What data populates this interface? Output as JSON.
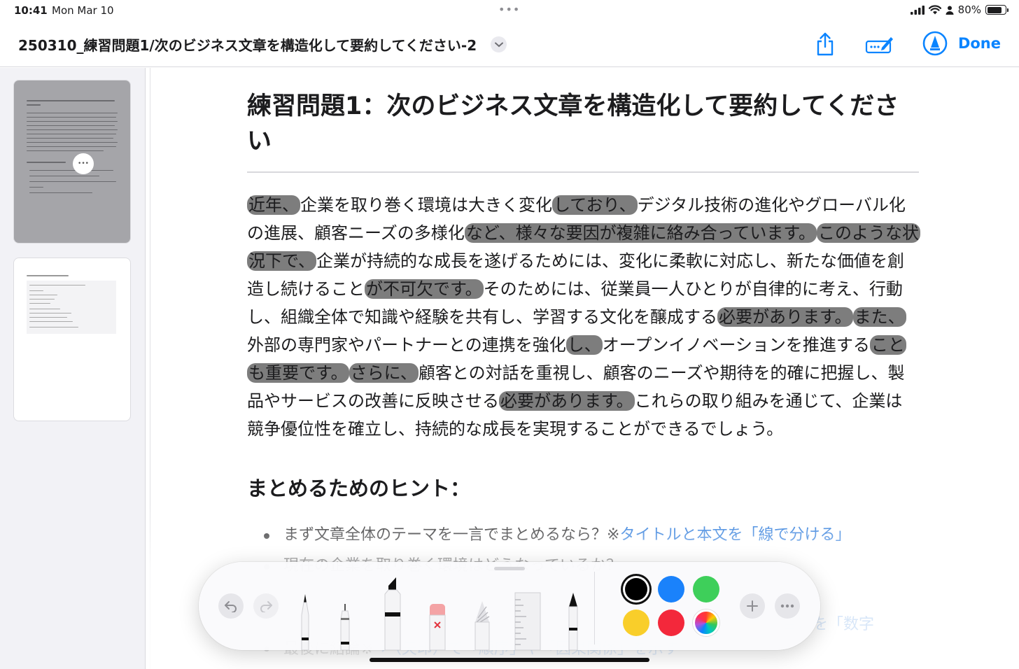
{
  "status_bar": {
    "time": "10:41",
    "date": "Mon Mar 10",
    "battery": "80%",
    "battery_level": 0.8,
    "multitask_dots": "•••"
  },
  "nav_bar": {
    "title": "250310_練習問題1/次のビジネス文章を構造化して要約してください-2",
    "done_label": "Done"
  },
  "sidebar": {
    "thumb_menu": "•••"
  },
  "document": {
    "heading": "練習問題1：次のビジネス文章を構造化して要約してください",
    "paragraph": [
      {
        "t": "近年、",
        "m": true
      },
      {
        "t": "企業を取り巻く環境は大きく変化",
        "m": false
      },
      {
        "t": "しており、",
        "m": true
      },
      {
        "t": "デジタル技術の進化やグローバル化の進展、顧客ニーズの多様化",
        "m": false
      },
      {
        "t": "など、様々な要因が複雑に絡み合っています。",
        "m": true
      },
      {
        "t": "このような状況下で、",
        "m": true
      },
      {
        "t": "企業が持続的な成長を遂げるためには、変化に柔軟に対応し、新たな価値を創造し続けること",
        "m": false
      },
      {
        "t": "が不可欠です。",
        "m": true
      },
      {
        "t": "そのためには、従業員一人ひとりが自律的に考え、行動し、組織全体で知識や経験を共有し、学習する文化を醸成する",
        "m": false
      },
      {
        "t": "必要があります。",
        "m": true
      },
      {
        "t": "また、",
        "m": true
      },
      {
        "t": "外部の専門家やパートナーとの連携を強化",
        "m": false
      },
      {
        "t": "し、",
        "m": true
      },
      {
        "t": "オープンイノベーションを推進する",
        "m": false
      },
      {
        "t": "ことも重要です。",
        "m": true
      },
      {
        "t": "さらに、",
        "m": true
      },
      {
        "t": "顧客との対話を重視し、顧客のニーズや期待を的確に把握し、製品やサービスの改善に反映させる",
        "m": false
      },
      {
        "t": "必要があります。",
        "m": true
      },
      {
        "t": "これらの取り組みを通じて、企業は競争優位性を確立し、持続的な成長を実現することができるでしょう。",
        "m": false
      }
    ],
    "hints_heading": "まとめるためのヒント：",
    "hints": [
      {
        "text": "まず文章全体のテーマを一言でまとめるなら？※",
        "link": "タイトルと本文を「線で分ける」"
      },
      {
        "text": "現在の企業を取り巻く環境はどうなっているか？",
        "link": ""
      },
      {
        "text": "",
        "link": "目）を「数字"
      },
      {
        "text": "最後に結論※",
        "link": "→（矢印）で「順序」や「因果関係」を示す"
      }
    ]
  },
  "toolbar": {
    "colors": [
      "#000000",
      "#1a82fb",
      "#3ecf5a",
      "#f9ce2a",
      "#f3283b"
    ],
    "selected_color": "#000000"
  }
}
